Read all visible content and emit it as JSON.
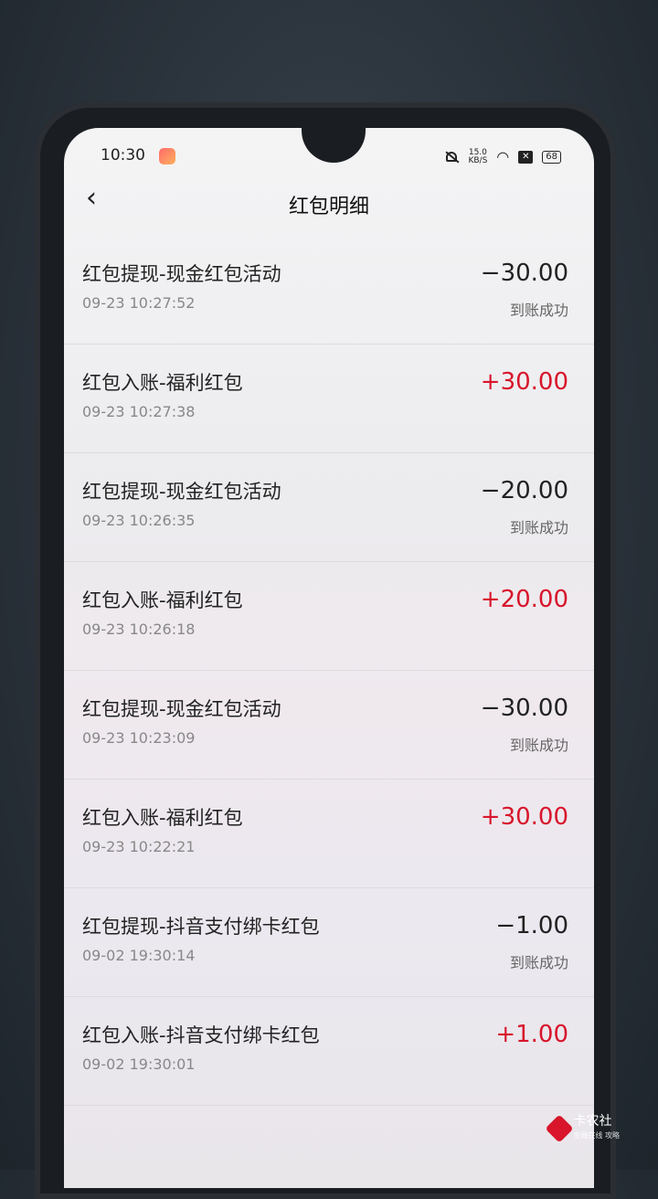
{
  "status_bar": {
    "time": "10:30",
    "speed_top": "15.0",
    "speed_unit": "KB/S",
    "battery": "68"
  },
  "header": {
    "back_icon": "chevron-left-icon",
    "title": "红包明细"
  },
  "records": [
    {
      "name": "红包提现-现金红包活动",
      "time": "09-23 10:27:52",
      "amount": "−30.00",
      "status": "到账成功",
      "positive": false
    },
    {
      "name": "红包入账-福利红包",
      "time": "09-23 10:27:38",
      "amount": "+30.00",
      "status": "",
      "positive": true
    },
    {
      "name": "红包提现-现金红包活动",
      "time": "09-23 10:26:35",
      "amount": "−20.00",
      "status": "到账成功",
      "positive": false
    },
    {
      "name": "红包入账-福利红包",
      "time": "09-23 10:26:18",
      "amount": "+20.00",
      "status": "",
      "positive": true
    },
    {
      "name": "红包提现-现金红包活动",
      "time": "09-23 10:23:09",
      "amount": "−30.00",
      "status": "到账成功",
      "positive": false
    },
    {
      "name": "红包入账-福利红包",
      "time": "09-23 10:22:21",
      "amount": "+30.00",
      "status": "",
      "positive": true
    },
    {
      "name": "红包提现-抖音支付绑卡红包",
      "time": "09-02 19:30:14",
      "amount": "−1.00",
      "status": "到账成功",
      "positive": false
    },
    {
      "name": "红包入账-抖音支付绑卡红包",
      "time": "09-02 19:30:01",
      "amount": "+1.00",
      "status": "",
      "positive": true
    }
  ],
  "watermark": {
    "text": "卡农社",
    "sub": "金融在线 攻略"
  },
  "colors": {
    "positive": "#d8152b",
    "negative": "#222222"
  }
}
